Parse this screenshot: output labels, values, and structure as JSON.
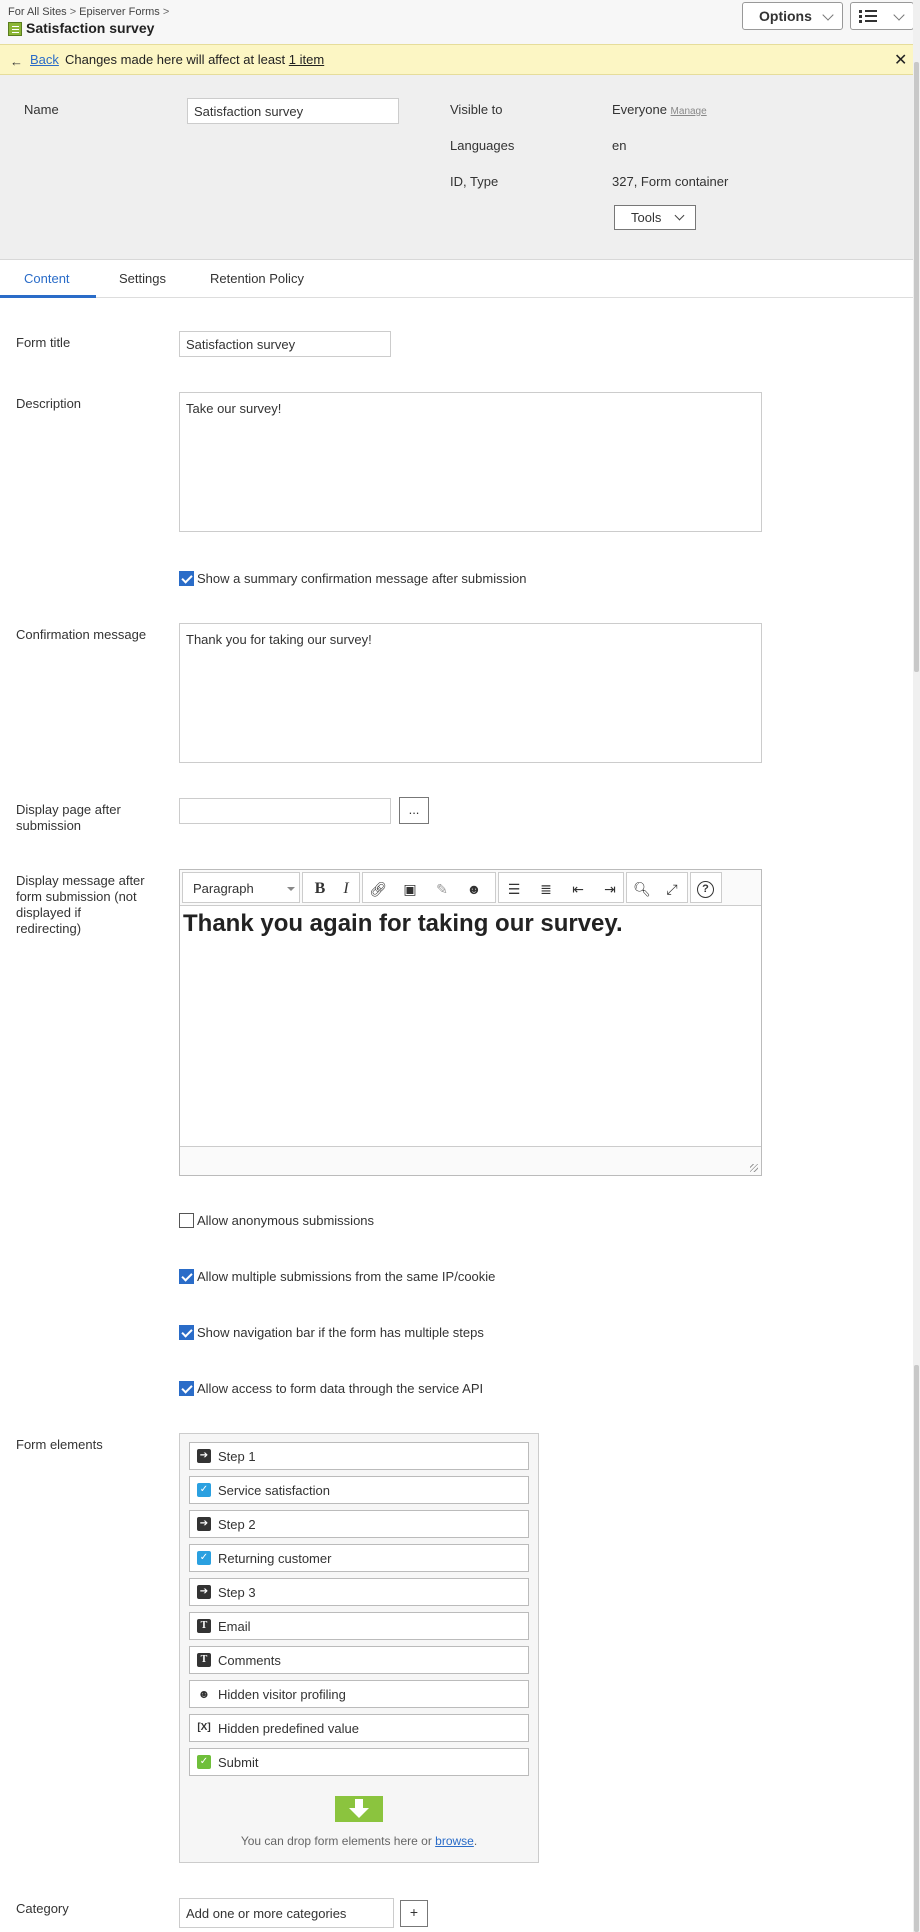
{
  "breadcrumb": [
    "For All Sites",
    "Episerver Forms"
  ],
  "page_title": "Satisfaction survey",
  "toolbar": {
    "options_label": "Options"
  },
  "notice": {
    "back_label": "Back",
    "message": "Changes made here will affect at least",
    "count_link": "1 item"
  },
  "info": {
    "name_label": "Name",
    "name_value": "Satisfaction survey",
    "visible_to_label": "Visible to",
    "visible_to_value": "Everyone",
    "manage_label": "Manage",
    "languages_label": "Languages",
    "languages_value": "en",
    "id_type_label": "ID, Type",
    "id_type_value": "327, Form container",
    "tools_label": "Tools"
  },
  "tabs": [
    {
      "label": "Content",
      "active": true
    },
    {
      "label": "Settings",
      "active": false
    },
    {
      "label": "Retention Policy",
      "active": false
    }
  ],
  "form": {
    "form_title_label": "Form title",
    "form_title_value": "Satisfaction survey",
    "description_label": "Description",
    "description_value": "Take our survey!",
    "show_summary_label": "Show a summary confirmation message after submission",
    "show_summary_checked": true,
    "confirmation_label": "Confirmation message",
    "confirmation_value": "Thank you for taking our survey!",
    "display_page_label_1": "Display page after",
    "display_page_label_2": "submission",
    "display_page_value": "",
    "browse_label": "...",
    "display_message_label_1": "Display message after",
    "display_message_label_2": "form submission (not",
    "display_message_label_3": "displayed if",
    "display_message_label_4": "redirecting)",
    "editor_format": "Paragraph",
    "editor_content": "Thank you again for taking our survey.",
    "allow_anonymous_label": "Allow anonymous submissions",
    "allow_anonymous_checked": false,
    "allow_multiple_label": "Allow multiple submissions from the same IP/cookie",
    "allow_multiple_checked": true,
    "show_nav_label": "Show navigation bar if the form has multiple steps",
    "show_nav_checked": true,
    "allow_api_label": "Allow access to form data through the service API",
    "allow_api_checked": true,
    "form_elements_label": "Form elements",
    "elements": [
      {
        "label": "Step 1",
        "icon": "step-icon"
      },
      {
        "label": "Service satisfaction",
        "icon": "checkbox-icon"
      },
      {
        "label": "Step 2",
        "icon": "step-icon"
      },
      {
        "label": "Returning customer",
        "icon": "checkbox-icon"
      },
      {
        "label": "Step 3",
        "icon": "step-icon"
      },
      {
        "label": "Email",
        "icon": "text-icon"
      },
      {
        "label": "Comments",
        "icon": "textarea-icon"
      },
      {
        "label": "Hidden visitor profiling",
        "icon": "visitor-icon"
      },
      {
        "label": "Hidden predefined value",
        "icon": "predefined-icon"
      },
      {
        "label": "Submit",
        "icon": "submit-icon"
      }
    ],
    "drop_text": "You can drop form elements here or",
    "drop_link": "browse",
    "category_label": "Category",
    "category_placeholder": "Add one or more categories",
    "add_category_label": "+"
  },
  "colors": {
    "accent": "#2a6cc8",
    "notice_bg": "#fcf6c4",
    "panel_bg": "#efefef",
    "drop_green": "#8bc43e"
  }
}
